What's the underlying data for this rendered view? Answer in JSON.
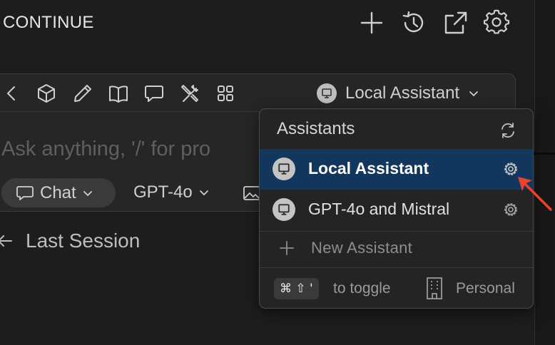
{
  "header": {
    "title": "CONTINUE",
    "icons": [
      "plus-icon",
      "history-icon",
      "external-open-icon",
      "gear-icon"
    ]
  },
  "toolbar": {
    "icons": [
      "back-chevron-icon",
      "cube-icon",
      "pencil-icon",
      "book-icon",
      "chat-bubble-icon",
      "tools-icon",
      "grid-icon"
    ],
    "assistant_label": "Local Assistant"
  },
  "input": {
    "placeholder": "Ask anything, '/' for pro"
  },
  "controls": {
    "mode_label": "Chat",
    "model_label": "GPT-4o"
  },
  "history": {
    "last_session_label": "Last Session"
  },
  "dropdown": {
    "header": "Assistants",
    "items": [
      {
        "label": "Local Assistant",
        "active": true
      },
      {
        "label": "GPT-4o and Mistral",
        "active": false
      }
    ],
    "new_assistant_label": "New Assistant",
    "shortcut_keys": "⌘ ⇧ '",
    "toggle_label": "to toggle",
    "org_label": "Personal"
  },
  "colors": {
    "background": "#1d1d1d",
    "card": "#262626",
    "active_item": "#13365c",
    "annotation_arrow": "#e5442e"
  }
}
